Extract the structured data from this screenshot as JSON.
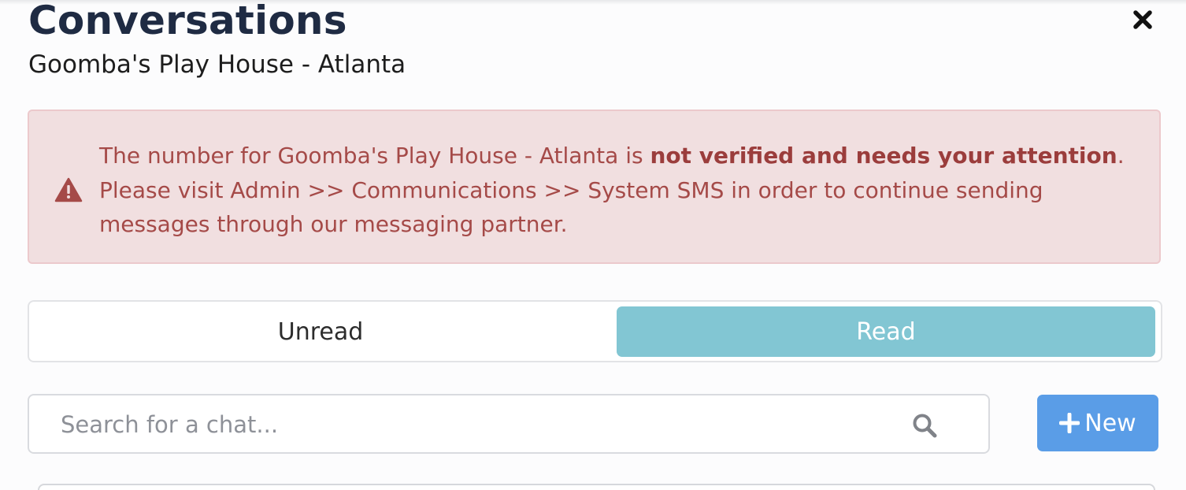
{
  "header": {
    "title": "Conversations",
    "subtitle": "Goomba's Play House - Atlanta",
    "close_icon": "close-icon"
  },
  "alert": {
    "icon": "warning-icon",
    "color": "#a54a48",
    "background": "#f1dfe0",
    "text_before": "The number for Goomba's Play House - Atlanta is ",
    "text_bold": "not verified and needs your attention",
    "text_after": ". Please visit Admin >> Communications >> System SMS in order to continue sending messages through our messaging partner."
  },
  "tabs": {
    "unread_label": "Unread",
    "read_label": "Read",
    "active": "read",
    "active_color": "#82c6d3"
  },
  "search": {
    "placeholder": "Search for a chat...",
    "value": "",
    "icon": "search-icon"
  },
  "new_button": {
    "label": "New",
    "icon": "plus-icon",
    "color": "#5a9de7"
  }
}
